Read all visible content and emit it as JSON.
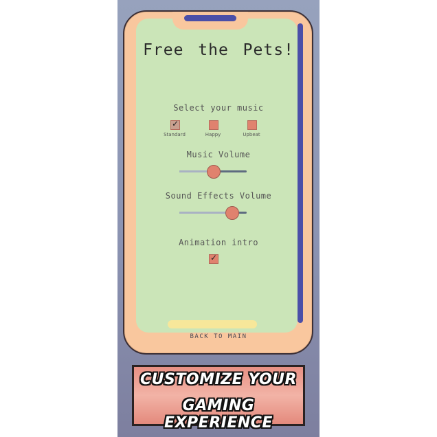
{
  "app": {
    "title": "Free the Pets!"
  },
  "music": {
    "label": "Select your music",
    "options": [
      {
        "label": "Standard",
        "checked": true
      },
      {
        "label": "Happy",
        "checked": false
      },
      {
        "label": "Upbeat",
        "checked": false
      }
    ]
  },
  "music_volume": {
    "label": "Music Volume",
    "level": 0.5
  },
  "sfx_volume": {
    "label": "Sound Effects Volume",
    "level": 0.78
  },
  "intro": {
    "label": "Animation intro",
    "checked": true
  },
  "nav": {
    "back_label": "BACK TO MAIN"
  },
  "banner": {
    "line1": "CUSTOMIZE YOUR",
    "line2": "GAMING EXPERIENCE"
  },
  "colors": {
    "screen": "#cbe5b8",
    "frame": "#f9c79e",
    "accent": "#e0826e",
    "bar": "#4b4fa8"
  }
}
